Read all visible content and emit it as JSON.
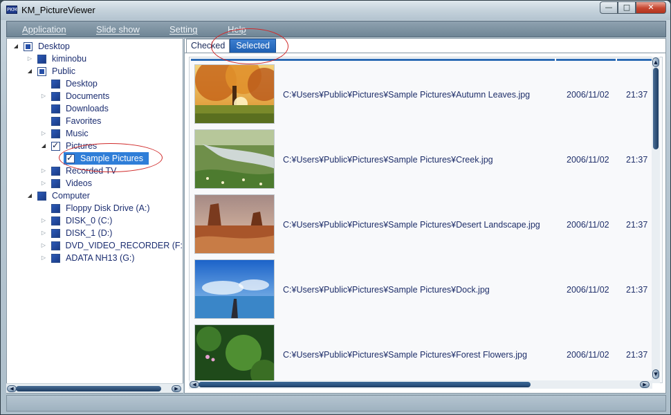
{
  "window": {
    "title": "KM_PictureViewer",
    "icon_text": "PKM",
    "controls": {
      "minimize": "—",
      "maximize": "□",
      "close": "✕"
    }
  },
  "menu": {
    "items": [
      "Application",
      "Slide show",
      "Setting",
      "Help"
    ]
  },
  "tree": {
    "nodes": [
      {
        "label": "Desktop",
        "state": "partial",
        "expanded": true
      },
      {
        "label": "kiminobu",
        "state": "unchecked",
        "expanded": false
      },
      {
        "label": "Public",
        "state": "partial",
        "expanded": true
      },
      {
        "label": "Desktop",
        "state": "unchecked"
      },
      {
        "label": "Documents",
        "state": "unchecked",
        "expandable": true
      },
      {
        "label": "Downloads",
        "state": "unchecked"
      },
      {
        "label": "Favorites",
        "state": "unchecked"
      },
      {
        "label": "Music",
        "state": "unchecked",
        "expandable": true
      },
      {
        "label": "Pictures",
        "state": "checked",
        "expanded": true
      },
      {
        "label": "Sample Pictures",
        "state": "checked",
        "selected": true
      },
      {
        "label": "Recorded TV",
        "state": "unchecked",
        "expandable": true
      },
      {
        "label": "Videos",
        "state": "unchecked",
        "expandable": true
      },
      {
        "label": "Computer",
        "state": "unchecked",
        "expanded": true
      },
      {
        "label": "Floppy Disk Drive (A:)",
        "state": "unchecked"
      },
      {
        "label": "DISK_0 (C:)",
        "state": "unchecked",
        "expandable": true
      },
      {
        "label": "DISK_1 (D:)",
        "state": "unchecked",
        "expandable": true
      },
      {
        "label": "DVD_VIDEO_RECORDER (F:",
        "state": "unchecked",
        "expandable": true
      },
      {
        "label": "ADATA NH13 (G:)",
        "state": "unchecked",
        "expandable": true
      }
    ]
  },
  "tabs": [
    {
      "label": "Checked",
      "active": false
    },
    {
      "label": "Selected",
      "active": true
    }
  ],
  "files": [
    {
      "path": "C:¥Users¥Public¥Pictures¥Sample Pictures¥Autumn Leaves.jpg",
      "date": "2006/11/02",
      "time": "21:37",
      "thumbnail": "autumn-leaves"
    },
    {
      "path": "C:¥Users¥Public¥Pictures¥Sample Pictures¥Creek.jpg",
      "date": "2006/11/02",
      "time": "21:37",
      "thumbnail": "creek"
    },
    {
      "path": "C:¥Users¥Public¥Pictures¥Sample Pictures¥Desert Landscape.jpg",
      "date": "2006/11/02",
      "time": "21:37",
      "thumbnail": "desert-landscape"
    },
    {
      "path": "C:¥Users¥Public¥Pictures¥Sample Pictures¥Dock.jpg",
      "date": "2006/11/02",
      "time": "21:37",
      "thumbnail": "dock"
    },
    {
      "path": "C:¥Users¥Public¥Pictures¥Sample Pictures¥Forest Flowers.jpg",
      "date": "2006/11/02",
      "time": "21:37",
      "thumbnail": "forest-flowers"
    }
  ],
  "colors": {
    "accent": "#2f7ed8",
    "callout": "#d02a2a",
    "menu_bg": "#7e93a3"
  },
  "icons": {
    "expander_open": "◢",
    "expander_closed": "▷",
    "check": "✓",
    "arrow_up": "▲",
    "arrow_down": "▼",
    "arrow_left": "◀",
    "arrow_right": "▶"
  }
}
